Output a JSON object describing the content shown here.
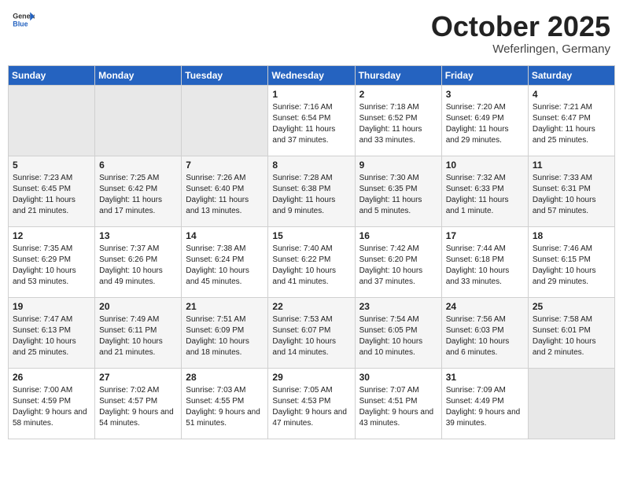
{
  "logo": {
    "general": "General",
    "blue": "Blue"
  },
  "header": {
    "month": "October 2025",
    "location": "Weferlingen, Germany"
  },
  "weekdays": [
    "Sunday",
    "Monday",
    "Tuesday",
    "Wednesday",
    "Thursday",
    "Friday",
    "Saturday"
  ],
  "weeks": [
    [
      {
        "day": "",
        "sunrise": "",
        "sunset": "",
        "daylight": ""
      },
      {
        "day": "",
        "sunrise": "",
        "sunset": "",
        "daylight": ""
      },
      {
        "day": "",
        "sunrise": "",
        "sunset": "",
        "daylight": ""
      },
      {
        "day": "1",
        "sunrise": "Sunrise: 7:16 AM",
        "sunset": "Sunset: 6:54 PM",
        "daylight": "Daylight: 11 hours and 37 minutes."
      },
      {
        "day": "2",
        "sunrise": "Sunrise: 7:18 AM",
        "sunset": "Sunset: 6:52 PM",
        "daylight": "Daylight: 11 hours and 33 minutes."
      },
      {
        "day": "3",
        "sunrise": "Sunrise: 7:20 AM",
        "sunset": "Sunset: 6:49 PM",
        "daylight": "Daylight: 11 hours and 29 minutes."
      },
      {
        "day": "4",
        "sunrise": "Sunrise: 7:21 AM",
        "sunset": "Sunset: 6:47 PM",
        "daylight": "Daylight: 11 hours and 25 minutes."
      }
    ],
    [
      {
        "day": "5",
        "sunrise": "Sunrise: 7:23 AM",
        "sunset": "Sunset: 6:45 PM",
        "daylight": "Daylight: 11 hours and 21 minutes."
      },
      {
        "day": "6",
        "sunrise": "Sunrise: 7:25 AM",
        "sunset": "Sunset: 6:42 PM",
        "daylight": "Daylight: 11 hours and 17 minutes."
      },
      {
        "day": "7",
        "sunrise": "Sunrise: 7:26 AM",
        "sunset": "Sunset: 6:40 PM",
        "daylight": "Daylight: 11 hours and 13 minutes."
      },
      {
        "day": "8",
        "sunrise": "Sunrise: 7:28 AM",
        "sunset": "Sunset: 6:38 PM",
        "daylight": "Daylight: 11 hours and 9 minutes."
      },
      {
        "day": "9",
        "sunrise": "Sunrise: 7:30 AM",
        "sunset": "Sunset: 6:35 PM",
        "daylight": "Daylight: 11 hours and 5 minutes."
      },
      {
        "day": "10",
        "sunrise": "Sunrise: 7:32 AM",
        "sunset": "Sunset: 6:33 PM",
        "daylight": "Daylight: 11 hours and 1 minute."
      },
      {
        "day": "11",
        "sunrise": "Sunrise: 7:33 AM",
        "sunset": "Sunset: 6:31 PM",
        "daylight": "Daylight: 10 hours and 57 minutes."
      }
    ],
    [
      {
        "day": "12",
        "sunrise": "Sunrise: 7:35 AM",
        "sunset": "Sunset: 6:29 PM",
        "daylight": "Daylight: 10 hours and 53 minutes."
      },
      {
        "day": "13",
        "sunrise": "Sunrise: 7:37 AM",
        "sunset": "Sunset: 6:26 PM",
        "daylight": "Daylight: 10 hours and 49 minutes."
      },
      {
        "day": "14",
        "sunrise": "Sunrise: 7:38 AM",
        "sunset": "Sunset: 6:24 PM",
        "daylight": "Daylight: 10 hours and 45 minutes."
      },
      {
        "day": "15",
        "sunrise": "Sunrise: 7:40 AM",
        "sunset": "Sunset: 6:22 PM",
        "daylight": "Daylight: 10 hours and 41 minutes."
      },
      {
        "day": "16",
        "sunrise": "Sunrise: 7:42 AM",
        "sunset": "Sunset: 6:20 PM",
        "daylight": "Daylight: 10 hours and 37 minutes."
      },
      {
        "day": "17",
        "sunrise": "Sunrise: 7:44 AM",
        "sunset": "Sunset: 6:18 PM",
        "daylight": "Daylight: 10 hours and 33 minutes."
      },
      {
        "day": "18",
        "sunrise": "Sunrise: 7:46 AM",
        "sunset": "Sunset: 6:15 PM",
        "daylight": "Daylight: 10 hours and 29 minutes."
      }
    ],
    [
      {
        "day": "19",
        "sunrise": "Sunrise: 7:47 AM",
        "sunset": "Sunset: 6:13 PM",
        "daylight": "Daylight: 10 hours and 25 minutes."
      },
      {
        "day": "20",
        "sunrise": "Sunrise: 7:49 AM",
        "sunset": "Sunset: 6:11 PM",
        "daylight": "Daylight: 10 hours and 21 minutes."
      },
      {
        "day": "21",
        "sunrise": "Sunrise: 7:51 AM",
        "sunset": "Sunset: 6:09 PM",
        "daylight": "Daylight: 10 hours and 18 minutes."
      },
      {
        "day": "22",
        "sunrise": "Sunrise: 7:53 AM",
        "sunset": "Sunset: 6:07 PM",
        "daylight": "Daylight: 10 hours and 14 minutes."
      },
      {
        "day": "23",
        "sunrise": "Sunrise: 7:54 AM",
        "sunset": "Sunset: 6:05 PM",
        "daylight": "Daylight: 10 hours and 10 minutes."
      },
      {
        "day": "24",
        "sunrise": "Sunrise: 7:56 AM",
        "sunset": "Sunset: 6:03 PM",
        "daylight": "Daylight: 10 hours and 6 minutes."
      },
      {
        "day": "25",
        "sunrise": "Sunrise: 7:58 AM",
        "sunset": "Sunset: 6:01 PM",
        "daylight": "Daylight: 10 hours and 2 minutes."
      }
    ],
    [
      {
        "day": "26",
        "sunrise": "Sunrise: 7:00 AM",
        "sunset": "Sunset: 4:59 PM",
        "daylight": "Daylight: 9 hours and 58 minutes."
      },
      {
        "day": "27",
        "sunrise": "Sunrise: 7:02 AM",
        "sunset": "Sunset: 4:57 PM",
        "daylight": "Daylight: 9 hours and 54 minutes."
      },
      {
        "day": "28",
        "sunrise": "Sunrise: 7:03 AM",
        "sunset": "Sunset: 4:55 PM",
        "daylight": "Daylight: 9 hours and 51 minutes."
      },
      {
        "day": "29",
        "sunrise": "Sunrise: 7:05 AM",
        "sunset": "Sunset: 4:53 PM",
        "daylight": "Daylight: 9 hours and 47 minutes."
      },
      {
        "day": "30",
        "sunrise": "Sunrise: 7:07 AM",
        "sunset": "Sunset: 4:51 PM",
        "daylight": "Daylight: 9 hours and 43 minutes."
      },
      {
        "day": "31",
        "sunrise": "Sunrise: 7:09 AM",
        "sunset": "Sunset: 4:49 PM",
        "daylight": "Daylight: 9 hours and 39 minutes."
      },
      {
        "day": "",
        "sunrise": "",
        "sunset": "",
        "daylight": ""
      }
    ]
  ]
}
